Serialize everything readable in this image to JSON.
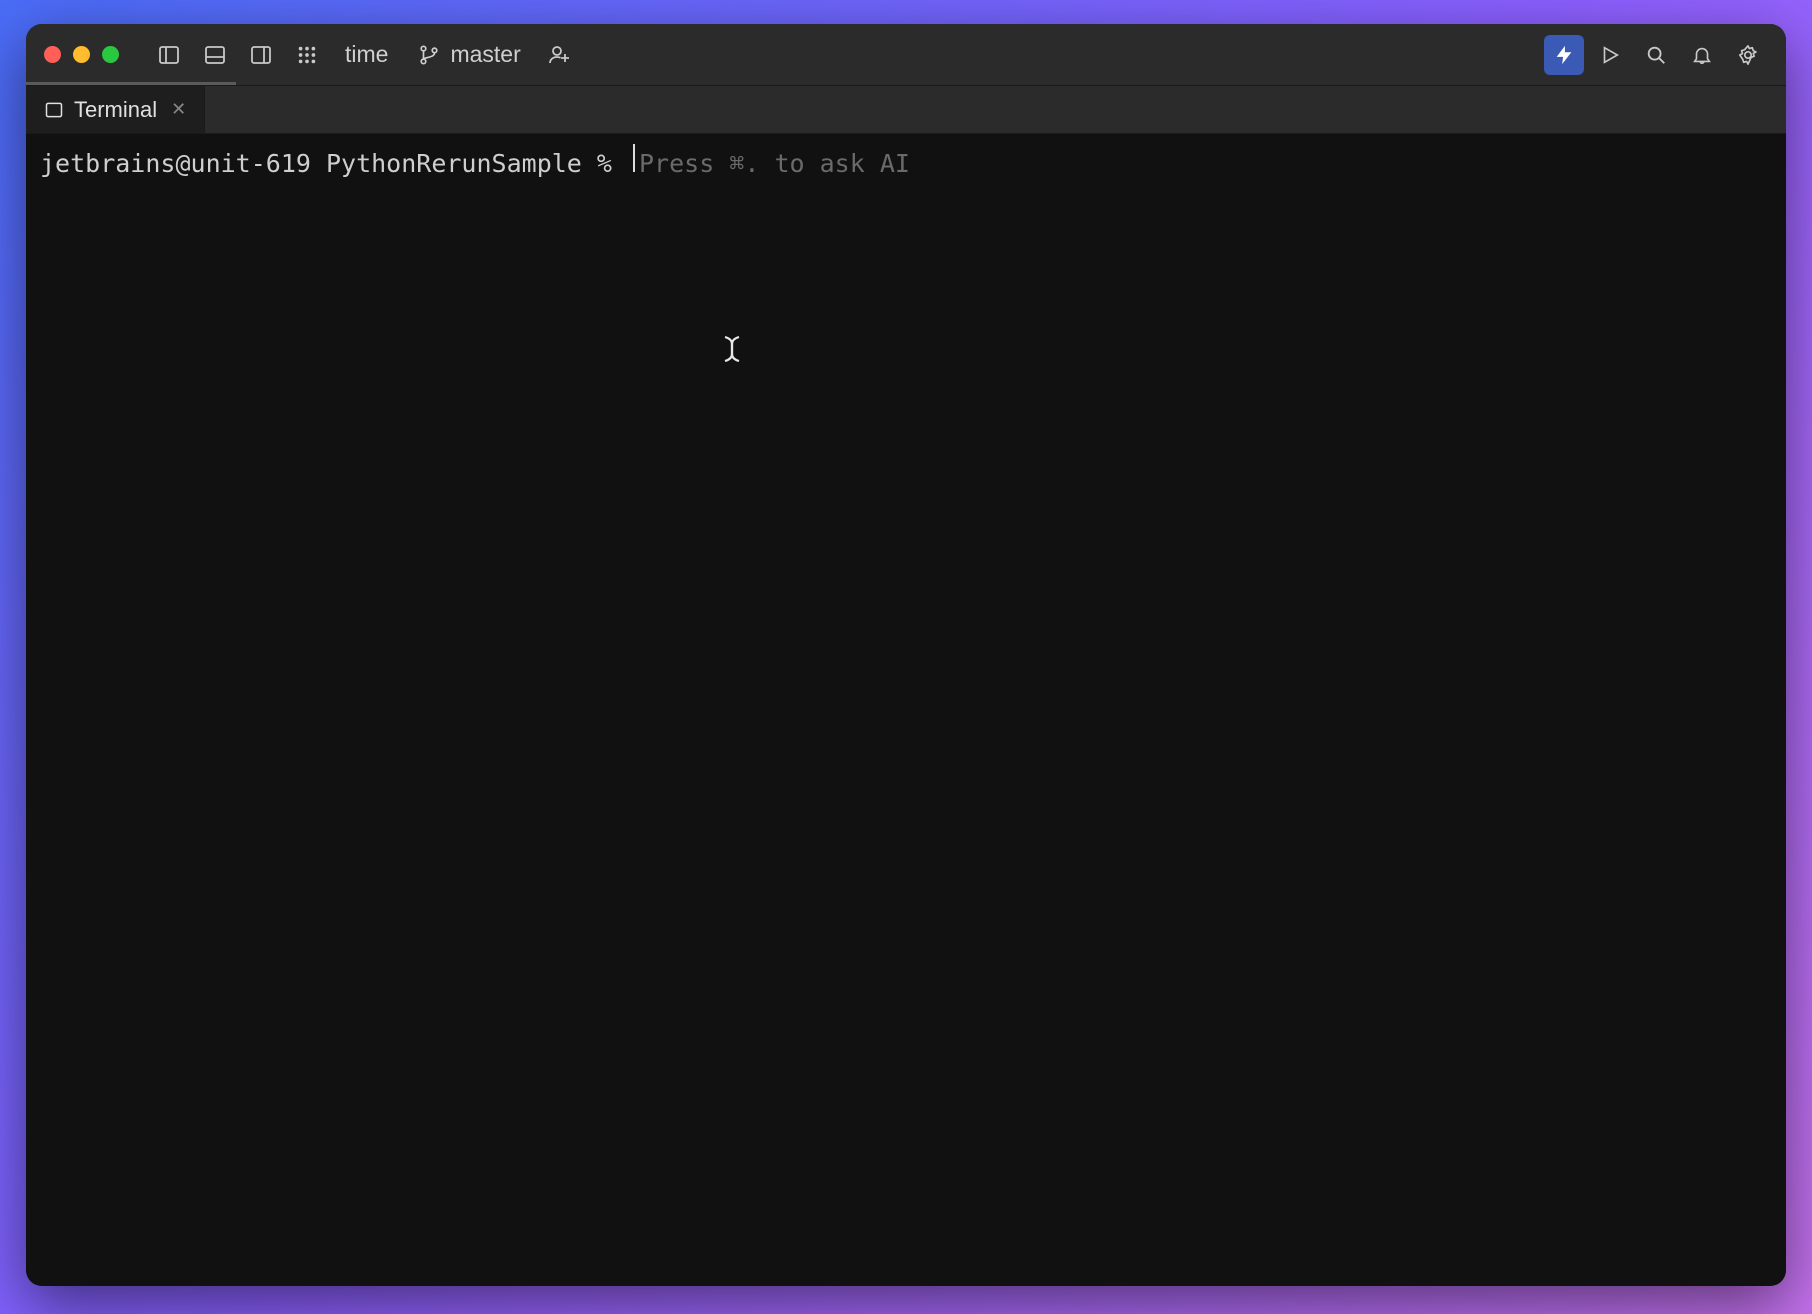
{
  "titlebar": {
    "project_label": "time",
    "branch_label": "master"
  },
  "tab": {
    "label": "Terminal"
  },
  "terminal": {
    "prompt": "jetbrains@unit-619 PythonRerunSample % ",
    "hint": "Press ⌘. to ask AI"
  }
}
